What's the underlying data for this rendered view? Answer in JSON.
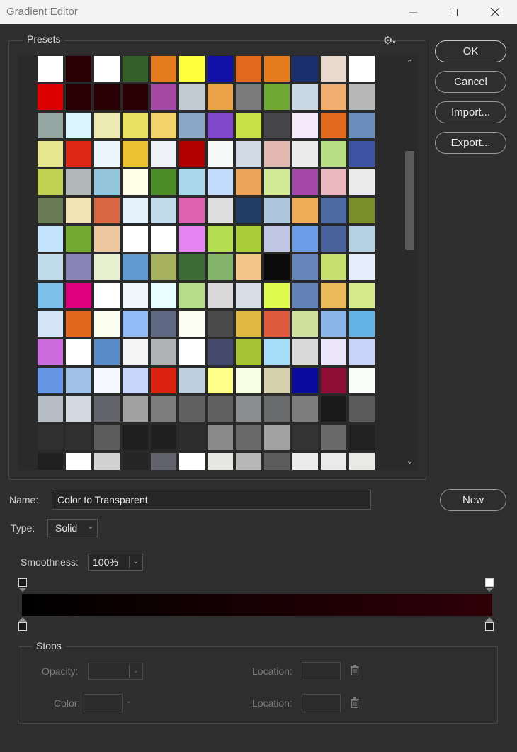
{
  "window": {
    "title": "Gradient Editor"
  },
  "presets": {
    "label": "Presets",
    "gear_icon": "gear-icon",
    "rows": [
      [
        "#ffffff",
        "#2a0004",
        "#ffffff",
        "#335f28",
        "#e57c1e",
        "#ffff3c",
        "#1010a8",
        "#e2691e",
        "#e57c1e",
        "#1b2f6e",
        "#e9d8cc",
        "#ffffff"
      ],
      [
        "#dc0000",
        "#2a0004",
        "#2a0004",
        "#2a0004",
        "#a548a2",
        "#c3cbd2",
        "#eaa248",
        "#7b7b7b",
        "#6fa833",
        "#c9d8e2",
        "#efae6f",
        "#b8b8b8"
      ],
      [
        "#96a7a3",
        "#daf5ff",
        "#ede9b2",
        "#e8e060",
        "#f2d46b",
        "#89a8c7",
        "#8047cb",
        "#c7e043",
        "#46464a",
        "#f4e8fa",
        "#e2691e",
        "#6a8dbb"
      ],
      [
        "#e6e68e",
        "#dc2815",
        "#edf5ff",
        "#edc132",
        "#eef2f6",
        "#b20000",
        "#f7f8f8",
        "#d2dbe5",
        "#e2b8b0",
        "#ececec",
        "#b8de83",
        "#3c54a2"
      ],
      [
        "#c0d050",
        "#b1b6b8",
        "#93c6dc",
        "#ffffe8",
        "#4a8c26",
        "#aad8ed",
        "#c1dcfc",
        "#eba45a",
        "#d1eb97",
        "#a547a8",
        "#ecb8bf",
        "#ececec"
      ],
      [
        "#6a7c55",
        "#f1e5b4",
        "#d96744",
        "#e6f2fb",
        "#c1dbea",
        "#df62b0",
        "#dfdfdf",
        "#1f3c62",
        "#adc6dd",
        "#efad57",
        "#4c6ba3",
        "#7b8d29"
      ],
      [
        "#c4e3fc",
        "#73aa34",
        "#efc79f",
        "#ffffff",
        "#ffffff",
        "#e683f0",
        "#b5dd52",
        "#a8cd37",
        "#bfc7e4",
        "#6b9de7",
        "#4a629b",
        "#b5d0e2"
      ],
      [
        "#c0dbea",
        "#8986b7",
        "#e7f0cf",
        "#5f9bd0",
        "#a8b35f",
        "#3d6b36",
        "#85b56d",
        "#f3c688",
        "#0b0b0b",
        "#6685bb",
        "#c6e06e",
        "#e5effc"
      ],
      [
        "#7dc1ea",
        "#df0081",
        "#ffffff",
        "#eff7fd",
        "#e9ffff",
        "#b7dc8a",
        "#d9d9d9",
        "#d8dee7",
        "#dffb4e",
        "#6382b7",
        "#ebb85a",
        "#d7ea8e"
      ],
      [
        "#d4e3f6",
        "#e2681f",
        "#fcfff0",
        "#91bbf7",
        "#606983",
        "#fdfef2",
        "#4a4a4a",
        "#dfb942",
        "#e05a3f",
        "#cee09c",
        "#8ab5ea",
        "#64b3e4"
      ],
      [
        "#cb6bde",
        "#ffffff",
        "#5a8cca",
        "#f4f5f4",
        "#b1b4b6",
        "#ffffff",
        "#434a6b",
        "#a4c433",
        "#a6defa",
        "#dadada",
        "#eae5f8",
        "#c8d3fa"
      ],
      [
        "#6696e5",
        "#a0c1e8",
        "#f5f9ff",
        "#c8d6fb",
        "#dc230f",
        "#bdd1df",
        "#fdff88",
        "#f7ffe5",
        "#d6d1ac",
        "#0b0b9d",
        "#8e0e37",
        "#fbfdf8"
      ],
      [
        "#b7bdc7",
        "#d2d8df",
        "#63636b",
        "#a1a1a1",
        "#7d7d7d",
        "#606060",
        "#606060",
        "#8b8d8f",
        "#6a6b6d",
        "#7d7d7d",
        "#1a1a1a",
        "#5b5b5b"
      ],
      [
        "#303030",
        "#303030",
        "#5c5c5c",
        "#1f1f1f",
        "#1f1f1f",
        "#2d2d2d",
        "#8a8a8a",
        "#6a6a6a",
        "#a2a2a2",
        "#333333",
        "#6a6a6a",
        "#212121"
      ],
      [
        "#202020",
        "#ffffff",
        "#d2d2d2",
        "#252525",
        "#61616b",
        "#ffffff",
        "#e6e6e2",
        "#b8b8b8",
        "#5c5c5c",
        "#ececec",
        "#ebebeb",
        "#e9e9e7"
      ]
    ]
  },
  "buttons": {
    "ok": "OK",
    "cancel": "Cancel",
    "import": "Import...",
    "export": "Export...",
    "new": "New"
  },
  "name": {
    "label": "Name:",
    "value": "Color to Transparent"
  },
  "type": {
    "label": "Type:",
    "value": "Solid"
  },
  "smoothness": {
    "label": "Smoothness:",
    "value": "100%"
  },
  "gradient": {
    "start_color": "#000000",
    "end_color": "#2e0006"
  },
  "stops": {
    "label": "Stops",
    "opacity_label": "Opacity:",
    "color_label": "Color:",
    "location_label_1": "Location:",
    "location_label_2": "Location:"
  }
}
